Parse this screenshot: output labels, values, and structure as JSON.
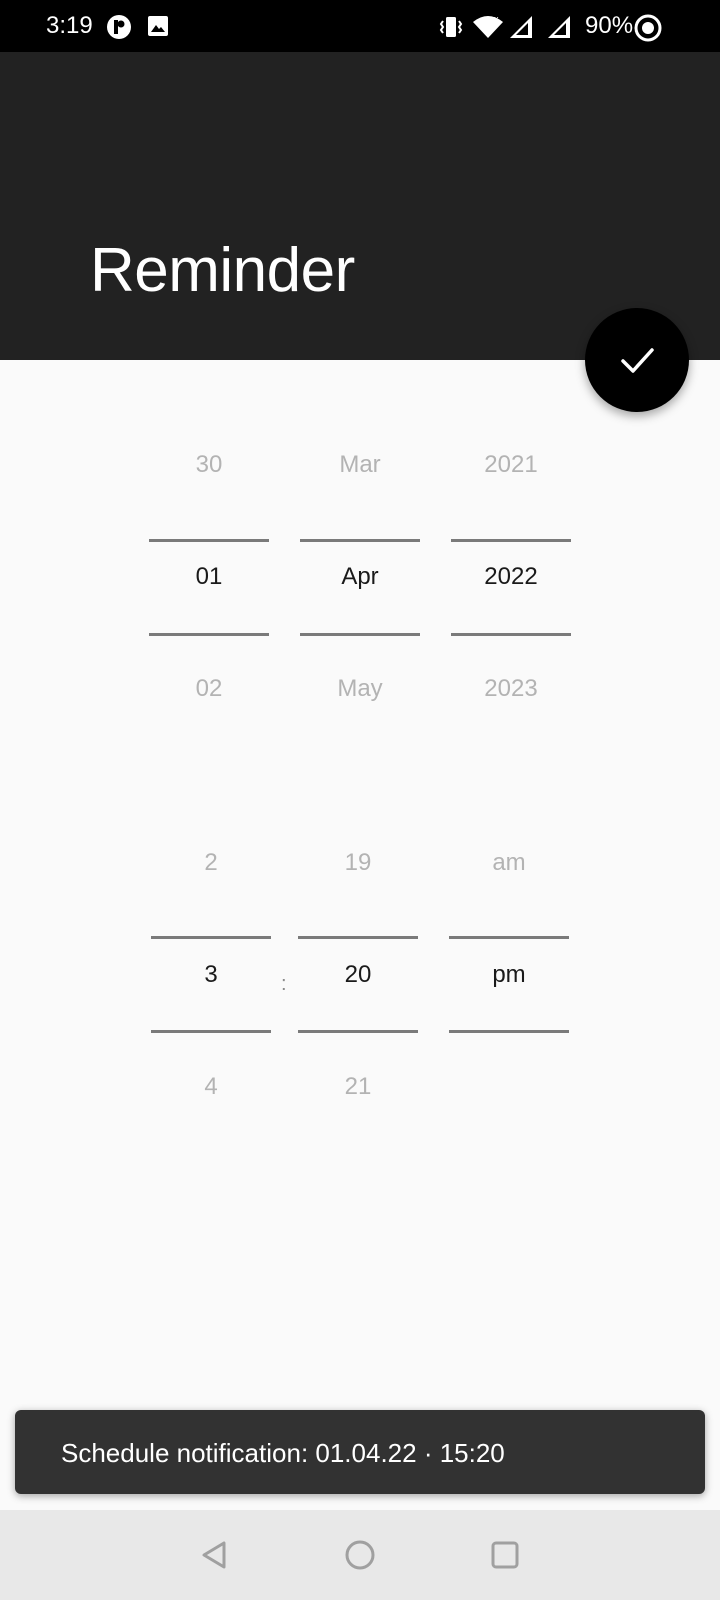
{
  "status_bar": {
    "time": "3:19",
    "battery": "90%",
    "icons": [
      "app-notification-icon",
      "gallery-icon",
      "vibrate-icon",
      "wifi-icon",
      "signal-icon",
      "signal-icon",
      "battery-icon"
    ]
  },
  "header": {
    "title": "Reminder"
  },
  "fab": {
    "icon": "check-icon"
  },
  "date_picker": {
    "day": {
      "prev": "30",
      "selected": "01",
      "next": "02"
    },
    "month": {
      "prev": "Mar",
      "selected": "Apr",
      "next": "May"
    },
    "year": {
      "prev": "2021",
      "selected": "2022",
      "next": "2023"
    }
  },
  "time_picker": {
    "hour": {
      "prev": "2",
      "selected": "3",
      "next": "4"
    },
    "separator": ":",
    "minute": {
      "prev": "19",
      "selected": "20",
      "next": "21"
    },
    "ampm": {
      "prev": "am",
      "selected": "pm",
      "next": ""
    }
  },
  "snackbar": {
    "text": "Schedule notification: 01.04.22 · 15:20"
  },
  "nav_bar": {
    "icons": [
      "back-icon",
      "home-icon",
      "recents-icon"
    ]
  },
  "colors": {
    "header_bg": "#222222",
    "fab_bg": "#000000",
    "snackbar_bg": "#323232",
    "nav_bg": "#e8e8e8",
    "page_bg": "#fafafa"
  }
}
